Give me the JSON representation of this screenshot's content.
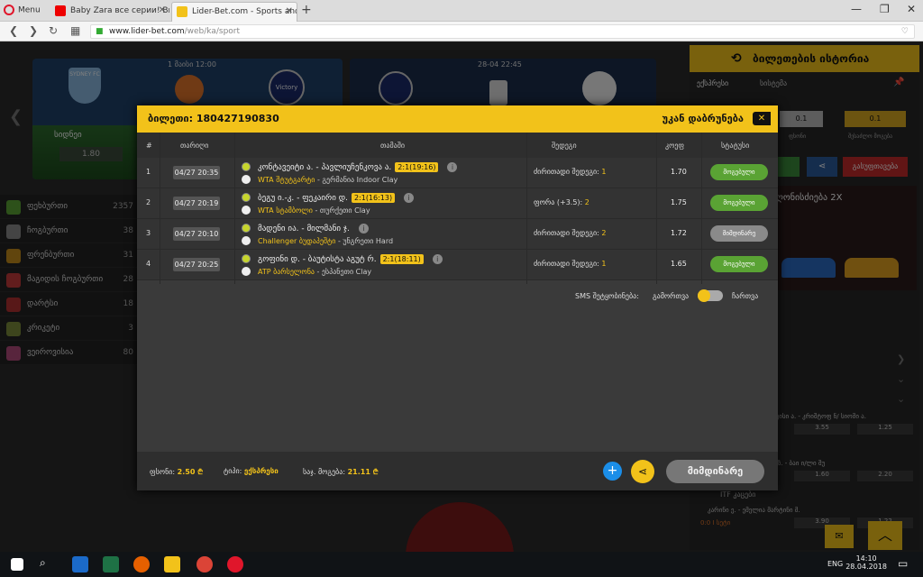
{
  "browser": {
    "menu_label": "Menu",
    "tabs": [
      {
        "title": "Baby Zara все серии! Вид"
      },
      {
        "title": "Lider-Bet.com - Sports and"
      }
    ],
    "new_tab": "+",
    "url_host": "www.lider-bet.com",
    "url_path": "/web/ka/sport"
  },
  "background": {
    "card1": {
      "time": "1 მაისი  12:00",
      "home": "SYDNEY FC",
      "away": "Victory",
      "label": "სიდნეი",
      "odd": "1.80"
    },
    "card2": {
      "time": "28-04   22:45"
    },
    "sidebar": [
      {
        "label": "ფეხბურთი",
        "count": "2357",
        "color": "#5aa334"
      },
      {
        "label": "ჩოგბურთი",
        "count": "38",
        "color": "#888"
      },
      {
        "label": "ფრენბურთი",
        "count": "31",
        "color": "#c28a1a"
      },
      {
        "label": "მაგიდის ჩოგბურთი",
        "count": "28",
        "color": "#c23a3a"
      },
      {
        "label": "დარტსი",
        "count": "18",
        "color": "#b03030"
      },
      {
        "label": "კრიკეტი",
        "count": "3",
        "color": "#7a8a3a"
      },
      {
        "label": "ვეიროვისია",
        "count": "80",
        "color": "#b04a7a"
      }
    ]
  },
  "right_panel": {
    "history_title": "ბილეთების ისტორია",
    "tab_express": "ექსპრესი",
    "tab_system": "სისტემა",
    "val1": "0.1",
    "val2": "0.1",
    "lbl1": "ფსონი",
    "lbl2": "შესაძლო მოგება",
    "clear_btn": "გასუფთავება",
    "promo": "ღონისძიება 2X",
    "list": [
      {
        "name": "შუისი ა. - კრიშტოფ ნ/ სიომი ა.",
        "o1": "3.55",
        "o2": "1.25"
      },
      {
        "name": "ბ ზ. - ბაი ი/ლი შუ",
        "o1": "1.60",
        "o2": "2.20"
      },
      {
        "name": "კარინი ე. - ემელია მარტინი მ.",
        "o1": "3.90",
        "o2": "1.22"
      }
    ],
    "itf": "ITF კაცები",
    "score_line": "0:0 I სეტი"
  },
  "modal": {
    "ticket_label": "ბილეთი:",
    "ticket_id": "180427190830",
    "back_label": "უკან დაბრუნება",
    "headers": {
      "num": "#",
      "date": "თარიღი",
      "event": "თამაში",
      "outcome": "შედეგი",
      "odd": "კოეფ",
      "status": "სტატუსი"
    },
    "rows": [
      {
        "num": "1",
        "date": "04/27 20:35",
        "match": "კონტავეიტი ა. - პავლიუჩენკოვა ა.",
        "score": "2:1(19:16)",
        "tour_type": "WTA შტუტგარტი",
        "tour_rest": " - გერმანია Indoor Clay",
        "out_label": "ძირითადი შედეგი: ",
        "out_val": "1",
        "odd": "1.70",
        "status": "მოგებული",
        "status_type": "win"
      },
      {
        "num": "2",
        "date": "04/27 20:19",
        "match": "ბეგუ ი.-კ. - ფეკაირი დ.",
        "score": "2:1(16:13)",
        "tour_type": "WTA სტამბოლი",
        "tour_rest": " - თურქეთი Clay",
        "out_label": "ფორა (+3.5): ",
        "out_val": "2",
        "odd": "1.75",
        "status": "მოგებული",
        "status_type": "win"
      },
      {
        "num": "3",
        "date": "04/27 20:10",
        "match": "მადენი ია. - მილმანი ჯ.",
        "score": "",
        "tour_type": "Challenger ბუდაპეშტი",
        "tour_rest": " - უნგრეთი Hard",
        "out_label": "ძირითადი შედეგი: ",
        "out_val": "2",
        "odd": "1.72",
        "status": "მიმდინარე",
        "status_type": "pend"
      },
      {
        "num": "4",
        "date": "04/27 20:25",
        "match": "გოფინი დ. - ბაუტისტა აგუტ რ.",
        "score": "2:1(18:11)",
        "tour_type": "ATP ბარსელონა",
        "tour_rest": " - ესპანეთი Clay",
        "out_label": "ძირითადი შედეგი: ",
        "out_val": "1",
        "odd": "1.65",
        "status": "მოგებული",
        "status_type": "win"
      }
    ],
    "sms_label": "SMS შეტყობინება:",
    "sms_off": "გამორთვა",
    "sms_on": "ჩართვა",
    "stake_label": "ფსონი:",
    "stake_val": "2.50 ₾",
    "type_label": "ტიპი:",
    "type_val": "ექსპრესი",
    "win_label": "საჯ. მოგება:",
    "win_val": "21.11 ₾",
    "live_btn": "მიმდინარე"
  },
  "taskbar": {
    "lang": "ENG",
    "time": "14:10",
    "date": "28.04.2018"
  }
}
